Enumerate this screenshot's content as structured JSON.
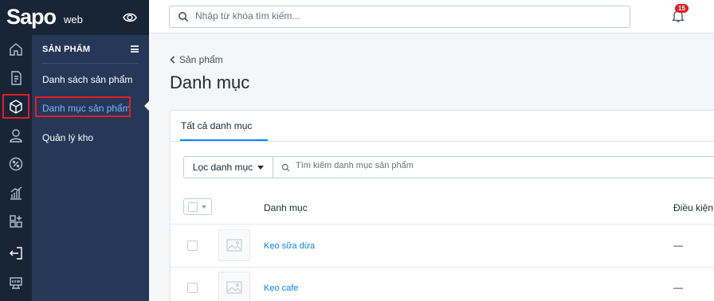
{
  "brand": {
    "logo": "Sapo",
    "logo_suffix": "web"
  },
  "rail": {
    "items": [
      "home-icon",
      "order-icon",
      "product-icon",
      "customer-icon",
      "discount-icon",
      "report-icon",
      "apps-icon",
      "exit-icon",
      "pos-icon"
    ]
  },
  "subnav": {
    "title": "SẢN PHẨM",
    "items": [
      {
        "label": "Danh sách sản phẩm"
      },
      {
        "label": "Danh mục sản phẩm"
      },
      {
        "label": "Quản lý kho"
      }
    ]
  },
  "topbar": {
    "search_placeholder": "Nhập từ khóa tìm kiếm...",
    "notification_count": "15"
  },
  "breadcrumb": {
    "back_label": "Sản phẩm"
  },
  "page": {
    "title": "Danh mục"
  },
  "tabs": [
    {
      "label": "Tất cả danh mục"
    }
  ],
  "filter": {
    "button_label": "Lọc danh mục",
    "search_placeholder": "Tìm kiếm danh mục sản phẩm"
  },
  "table": {
    "columns": [
      "Danh mục",
      "Điều kiện"
    ],
    "rows": [
      {
        "name": "Kẹo sữa dừa",
        "condition": "—"
      },
      {
        "name": "Kẹo cafe",
        "condition": "—"
      }
    ]
  },
  "colors": {
    "rail_bg": "#182537",
    "subnav_bg": "#253858",
    "accent": "#0088ff",
    "highlight": "#e11d26"
  }
}
